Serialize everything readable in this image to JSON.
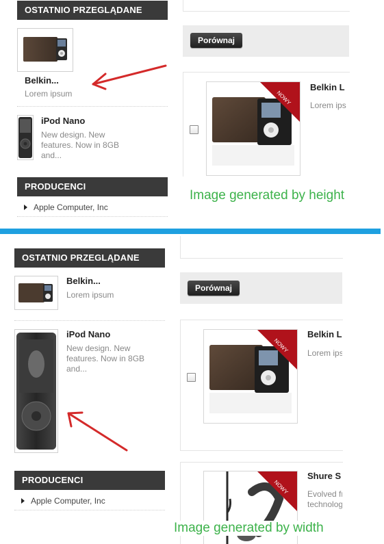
{
  "top": {
    "recent_header": "OSTATNIO PRZEGLĄDANE",
    "recent_items": [
      {
        "name": "Belkin...",
        "desc": "Lorem ipsum"
      },
      {
        "name": "iPod Nano",
        "desc_lines": [
          "New design. New",
          "features. Now in 8GB",
          "and..."
        ]
      }
    ],
    "producers_header": "PRODUCENCI",
    "producer_link": "Apple Computer, Inc",
    "compare_button": "Porównaj",
    "product_name": "Belkin L",
    "product_desc": "Lorem ips",
    "badge": "NOWY",
    "note": "Image generated by height"
  },
  "bottom": {
    "recent_header": "OSTATNIO PRZEGLĄDANE",
    "recent_items": [
      {
        "name": "Belkin...",
        "desc": "Lorem ipsum"
      },
      {
        "name": "iPod Nano",
        "desc_lines": [
          "New design. New",
          "features. Now in 8GB",
          "and..."
        ]
      }
    ],
    "producers_header": "PRODUCENCI",
    "producer_link": "Apple Computer, Inc",
    "compare_button": "Porównaj",
    "product_name": "Belkin L",
    "product_desc": "Lorem ips",
    "badge": "NOWY",
    "product2_name": "Shure S",
    "product2_desc_lines": [
      "Evolved fr",
      "technolog"
    ],
    "note": "Image generated by width"
  },
  "colors": {
    "header_bg": "#3a3a3a",
    "divider": "#1ea0e0",
    "note": "#3cb24a",
    "arrow": "#d42a2a",
    "badge": "#b0121b"
  }
}
